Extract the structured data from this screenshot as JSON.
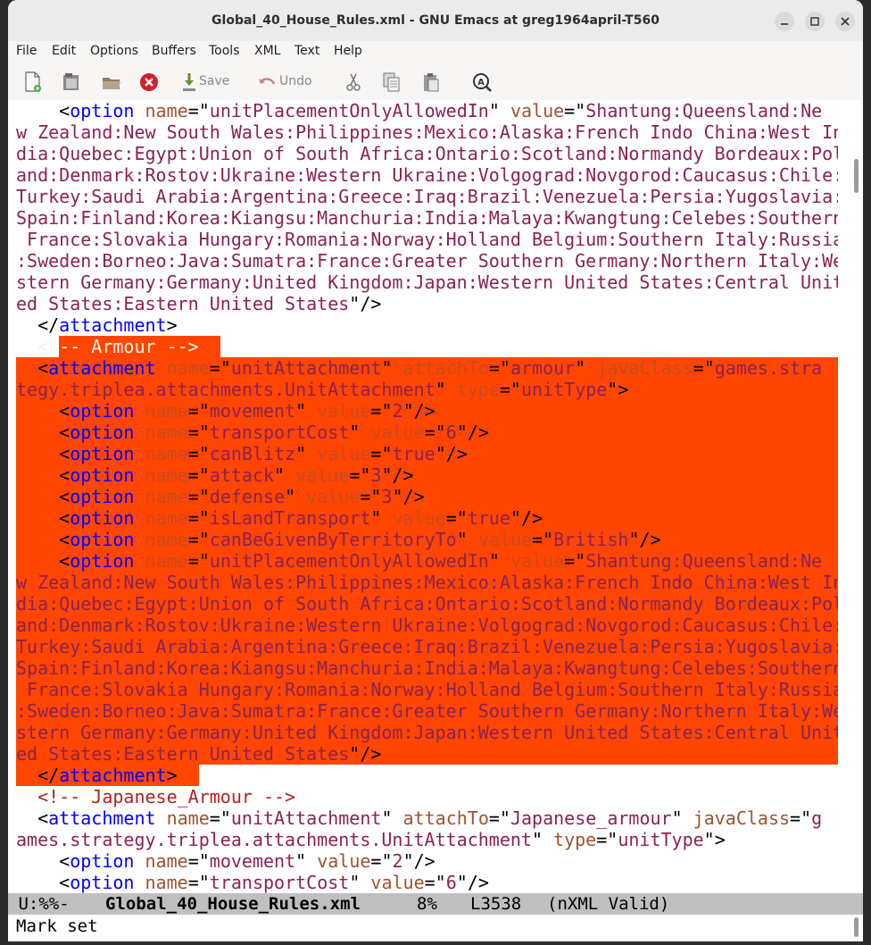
{
  "window": {
    "title": "Global_40_House_Rules.xml - GNU Emacs at greg1964april-T560"
  },
  "menu": [
    "File",
    "Edit",
    "Options",
    "Buffers",
    "Tools",
    "XML",
    "Text",
    "Help"
  ],
  "toolbar": {
    "save_label": "Save",
    "undo_label": "Undo"
  },
  "colors": {
    "tag": "#0000ff",
    "attr": "#a0522d",
    "string": "#8b2252",
    "comment": "#b22222",
    "highlight": "#ff4500"
  },
  "lines": [
    [
      {
        "t": "    <",
        "c": "p"
      },
      {
        "t": "option",
        "c": "tag"
      },
      {
        "t": " ",
        "c": "p"
      },
      {
        "t": "name",
        "c": "attr"
      },
      {
        "t": "=\"",
        "c": "p"
      },
      {
        "t": "unitPlacementOnlyAllowedIn",
        "c": "str"
      },
      {
        "t": "\" ",
        "c": "p"
      },
      {
        "t": "value",
        "c": "attr"
      },
      {
        "t": "=\"",
        "c": "p"
      },
      {
        "t": "Shantung:Queensland:Ne",
        "c": "str"
      }
    ],
    [
      {
        "t": "w Zealand:New South Wales:Philippines:Mexico:Alaska:French Indo China:West In",
        "c": "str"
      }
    ],
    [
      {
        "t": "dia:Quebec:Egypt:Union of South Africa:Ontario:Scotland:Normandy Bordeaux:Pol",
        "c": "str"
      }
    ],
    [
      {
        "t": "and:Denmark:Rostov:Ukraine:Western Ukraine:Volgograd:Novgorod:Caucasus:Chile:",
        "c": "str"
      }
    ],
    [
      {
        "t": "Turkey:Saudi Arabia:Argentina:Greece:Iraq:Brazil:Venezuela:Persia:Yugoslavia:",
        "c": "str"
      }
    ],
    [
      {
        "t": "Spain:Finland:Korea:Kiangsu:Manchuria:India:Malaya:Kwangtung:Celebes:Southern",
        "c": "str"
      }
    ],
    [
      {
        "t": " France:Slovakia Hungary:Romania:Norway:Holland Belgium:Southern Italy:Russia",
        "c": "str"
      }
    ],
    [
      {
        "t": ":Sweden:Borneo:Java:Sumatra:France:Greater Southern Germany:Northern Italy:We",
        "c": "str"
      }
    ],
    [
      {
        "t": "stern Germany:Germany:United Kingdom:Japan:Western United States:Central Unit",
        "c": "str"
      }
    ],
    [
      {
        "t": "ed States:Eastern United States",
        "c": "str"
      },
      {
        "t": "\"/>",
        "c": "p"
      }
    ],
    [
      {
        "t": "  </",
        "c": "p"
      },
      {
        "t": "attachment",
        "c": "tag"
      },
      {
        "t": ">",
        "c": "p"
      }
    ],
    [
      {
        "t": "  ",
        "c": "p"
      },
      {
        "t": "<!-- Armour -->",
        "c": "cm"
      }
    ],
    [
      {
        "t": "  <",
        "c": "p"
      },
      {
        "t": "attachment",
        "c": "tag"
      },
      {
        "t": " ",
        "c": "p"
      },
      {
        "t": "name",
        "c": "attr"
      },
      {
        "t": "=\"",
        "c": "p"
      },
      {
        "t": "unitAttachment",
        "c": "str"
      },
      {
        "t": "\" ",
        "c": "p"
      },
      {
        "t": "attachTo",
        "c": "attr"
      },
      {
        "t": "=\"",
        "c": "p"
      },
      {
        "t": "armour",
        "c": "str"
      },
      {
        "t": "\" ",
        "c": "p"
      },
      {
        "t": "javaClass",
        "c": "attr"
      },
      {
        "t": "=\"",
        "c": "p"
      },
      {
        "t": "games.stra",
        "c": "str"
      }
    ],
    [
      {
        "t": "tegy.triplea.attachments.UnitAttachment",
        "c": "str"
      },
      {
        "t": "\" ",
        "c": "p"
      },
      {
        "t": "type",
        "c": "attr"
      },
      {
        "t": "=\"",
        "c": "p"
      },
      {
        "t": "unitType",
        "c": "str"
      },
      {
        "t": "\">",
        "c": "p"
      }
    ],
    [
      {
        "t": "    <",
        "c": "p"
      },
      {
        "t": "option",
        "c": "tag"
      },
      {
        "t": " ",
        "c": "p"
      },
      {
        "t": "name",
        "c": "attr"
      },
      {
        "t": "=\"",
        "c": "p"
      },
      {
        "t": "movement",
        "c": "str"
      },
      {
        "t": "\" ",
        "c": "p"
      },
      {
        "t": "value",
        "c": "attr"
      },
      {
        "t": "=\"",
        "c": "p"
      },
      {
        "t": "2",
        "c": "str"
      },
      {
        "t": "\"/>",
        "c": "p"
      }
    ],
    [
      {
        "t": "    <",
        "c": "p"
      },
      {
        "t": "option",
        "c": "tag"
      },
      {
        "t": " ",
        "c": "p"
      },
      {
        "t": "name",
        "c": "attr"
      },
      {
        "t": "=\"",
        "c": "p"
      },
      {
        "t": "transportCost",
        "c": "str"
      },
      {
        "t": "\" ",
        "c": "p"
      },
      {
        "t": "value",
        "c": "attr"
      },
      {
        "t": "=\"",
        "c": "p"
      },
      {
        "t": "6",
        "c": "str"
      },
      {
        "t": "\"/>",
        "c": "p"
      }
    ],
    [
      {
        "t": "    <",
        "c": "p"
      },
      {
        "t": "option",
        "c": "tag"
      },
      {
        "t": " ",
        "c": "p"
      },
      {
        "t": "name",
        "c": "attr"
      },
      {
        "t": "=\"",
        "c": "p"
      },
      {
        "t": "canBlitz",
        "c": "str"
      },
      {
        "t": "\" ",
        "c": "p"
      },
      {
        "t": "value",
        "c": "attr"
      },
      {
        "t": "=\"",
        "c": "p"
      },
      {
        "t": "true",
        "c": "str"
      },
      {
        "t": "\"/>",
        "c": "p"
      }
    ],
    [
      {
        "t": "    <",
        "c": "p"
      },
      {
        "t": "option",
        "c": "tag"
      },
      {
        "t": " ",
        "c": "p"
      },
      {
        "t": "name",
        "c": "attr"
      },
      {
        "t": "=\"",
        "c": "p"
      },
      {
        "t": "attack",
        "c": "str"
      },
      {
        "t": "\" ",
        "c": "p"
      },
      {
        "t": "value",
        "c": "attr"
      },
      {
        "t": "=\"",
        "c": "p"
      },
      {
        "t": "3",
        "c": "str"
      },
      {
        "t": "\"/>",
        "c": "p"
      }
    ],
    [
      {
        "t": "    <",
        "c": "p"
      },
      {
        "t": "option",
        "c": "tag"
      },
      {
        "t": " ",
        "c": "p"
      },
      {
        "t": "name",
        "c": "attr"
      },
      {
        "t": "=\"",
        "c": "p"
      },
      {
        "t": "defense",
        "c": "str"
      },
      {
        "t": "\" ",
        "c": "p"
      },
      {
        "t": "value",
        "c": "attr"
      },
      {
        "t": "=\"",
        "c": "p"
      },
      {
        "t": "3",
        "c": "str"
      },
      {
        "t": "\"/>",
        "c": "p"
      }
    ],
    [
      {
        "t": "    <",
        "c": "p"
      },
      {
        "t": "option",
        "c": "tag"
      },
      {
        "t": " ",
        "c": "p"
      },
      {
        "t": "name",
        "c": "attr"
      },
      {
        "t": "=\"",
        "c": "p"
      },
      {
        "t": "isLandTransport",
        "c": "str"
      },
      {
        "t": "\" ",
        "c": "p"
      },
      {
        "t": "value",
        "c": "attr"
      },
      {
        "t": "=\"",
        "c": "p"
      },
      {
        "t": "true",
        "c": "str"
      },
      {
        "t": "\"/>",
        "c": "p"
      }
    ],
    [
      {
        "t": "    <",
        "c": "p"
      },
      {
        "t": "option",
        "c": "tag"
      },
      {
        "t": " ",
        "c": "p"
      },
      {
        "t": "name",
        "c": "attr"
      },
      {
        "t": "=\"",
        "c": "p"
      },
      {
        "t": "canBeGivenByTerritoryTo",
        "c": "str"
      },
      {
        "t": "\" ",
        "c": "p"
      },
      {
        "t": "value",
        "c": "attr"
      },
      {
        "t": "=\"",
        "c": "p"
      },
      {
        "t": "British",
        "c": "str"
      },
      {
        "t": "\"/>",
        "c": "p"
      }
    ],
    [
      {
        "t": "    <",
        "c": "p"
      },
      {
        "t": "option",
        "c": "tag"
      },
      {
        "t": " ",
        "c": "p"
      },
      {
        "t": "name",
        "c": "attr"
      },
      {
        "t": "=\"",
        "c": "p"
      },
      {
        "t": "unitPlacementOnlyAllowedIn",
        "c": "str"
      },
      {
        "t": "\" ",
        "c": "p"
      },
      {
        "t": "value",
        "c": "attr"
      },
      {
        "t": "=\"",
        "c": "p"
      },
      {
        "t": "Shantung:Queensland:Ne",
        "c": "str"
      }
    ],
    [
      {
        "t": "w Zealand:New South Wales:Philippines:Mexico:Alaska:French Indo China:West In",
        "c": "str"
      }
    ],
    [
      {
        "t": "dia:Quebec:Egypt:Union of South Africa:Ontario:Scotland:Normandy Bordeaux:Pol",
        "c": "str"
      }
    ],
    [
      {
        "t": "and:Denmark:Rostov:Ukraine:Western Ukraine:Volgograd:Novgorod:Caucasus:Chile:",
        "c": "str"
      }
    ],
    [
      {
        "t": "Turkey:Saudi Arabia:Argentina:Greece:Iraq:Brazil:Venezuela:Persia:Yugoslavia:",
        "c": "str"
      }
    ],
    [
      {
        "t": "Spain:Finland:Korea:Kiangsu:Manchuria:India:Malaya:Kwangtung:Celebes:Southern",
        "c": "str"
      }
    ],
    [
      {
        "t": " France:Slovakia Hungary:Romania:Norway:Holland Belgium:Southern Italy:Russia",
        "c": "str"
      }
    ],
    [
      {
        "t": ":Sweden:Borneo:Java:Sumatra:France:Greater Southern Germany:Northern Italy:We",
        "c": "str"
      }
    ],
    [
      {
        "t": "stern Germany:Germany:United Kingdom:Japan:Western United States:Central Unit",
        "c": "str"
      }
    ],
    [
      {
        "t": "ed States:Eastern United States",
        "c": "str"
      },
      {
        "t": "\"/>",
        "c": "p"
      }
    ],
    [
      {
        "t": "  </",
        "c": "p"
      },
      {
        "t": "attachment",
        "c": "tag"
      },
      {
        "t": ">",
        "c": "p"
      }
    ],
    [
      {
        "t": "  ",
        "c": "p"
      },
      {
        "t": "<!-- Japanese_Armour -->",
        "c": "cm"
      }
    ],
    [
      {
        "t": "  <",
        "c": "p"
      },
      {
        "t": "attachment",
        "c": "tag"
      },
      {
        "t": " ",
        "c": "p"
      },
      {
        "t": "name",
        "c": "attr"
      },
      {
        "t": "=\"",
        "c": "p"
      },
      {
        "t": "unitAttachment",
        "c": "str"
      },
      {
        "t": "\" ",
        "c": "p"
      },
      {
        "t": "attachTo",
        "c": "attr"
      },
      {
        "t": "=\"",
        "c": "p"
      },
      {
        "t": "Japanese_armour",
        "c": "str"
      },
      {
        "t": "\" ",
        "c": "p"
      },
      {
        "t": "javaClass",
        "c": "attr"
      },
      {
        "t": "=\"",
        "c": "p"
      },
      {
        "t": "g",
        "c": "str"
      }
    ],
    [
      {
        "t": "ames.strategy.triplea.attachments.UnitAttachment",
        "c": "str"
      },
      {
        "t": "\" ",
        "c": "p"
      },
      {
        "t": "type",
        "c": "attr"
      },
      {
        "t": "=\"",
        "c": "p"
      },
      {
        "t": "unitType",
        "c": "str"
      },
      {
        "t": "\">",
        "c": "p"
      }
    ],
    [
      {
        "t": "    <",
        "c": "p"
      },
      {
        "t": "option",
        "c": "tag"
      },
      {
        "t": " ",
        "c": "p"
      },
      {
        "t": "name",
        "c": "attr"
      },
      {
        "t": "=\"",
        "c": "p"
      },
      {
        "t": "movement",
        "c": "str"
      },
      {
        "t": "\" ",
        "c": "p"
      },
      {
        "t": "value",
        "c": "attr"
      },
      {
        "t": "=\"",
        "c": "p"
      },
      {
        "t": "2",
        "c": "str"
      },
      {
        "t": "\"/>",
        "c": "p"
      }
    ],
    [
      {
        "t": "    <",
        "c": "p"
      },
      {
        "t": "option",
        "c": "tag"
      },
      {
        "t": " ",
        "c": "p"
      },
      {
        "t": "name",
        "c": "attr"
      },
      {
        "t": "=\"",
        "c": "p"
      },
      {
        "t": "transportCost",
        "c": "str"
      },
      {
        "t": "\" ",
        "c": "p"
      },
      {
        "t": "value",
        "c": "attr"
      },
      {
        "t": "=\"",
        "c": "p"
      },
      {
        "t": "6",
        "c": "str"
      },
      {
        "t": "\"/>",
        "c": "p"
      }
    ]
  ],
  "modeline": {
    "status": " U:%%-",
    "buffer": "Global_40_House_Rules.xml",
    "percent": "8%",
    "line": "L3538",
    "mode": "(nXML Valid)"
  },
  "minibuffer": "Mark set"
}
